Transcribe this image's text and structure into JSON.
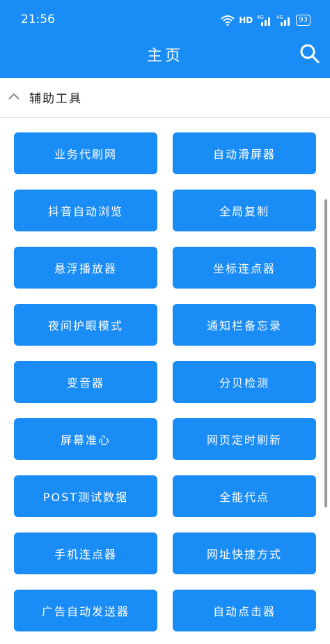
{
  "status_bar": {
    "time": "21:56",
    "network": "HD",
    "signal1": "4G",
    "signal2": "4G",
    "battery": "93"
  },
  "app_bar": {
    "title": "主页",
    "search_icon": "search-icon"
  },
  "section": {
    "title": "辅助工具",
    "chevron_icon": "chevron-up-icon"
  },
  "tools": [
    "业务代刷网",
    "自动滑屏器",
    "抖音自动浏览",
    "全局复制",
    "悬浮播放器",
    "坐标连点器",
    "夜间护眼模式",
    "通知栏备忘录",
    "变音器",
    "分贝检测",
    "屏幕准心",
    "网页定时刷新",
    "POST测试数据",
    "全能代点",
    "手机连点器",
    "网址快捷方式",
    "广告自动发送器",
    "自动点击器"
  ],
  "colors": {
    "primary": "#1a8cf5",
    "background": "#ffffff",
    "text_dark": "#222222"
  }
}
